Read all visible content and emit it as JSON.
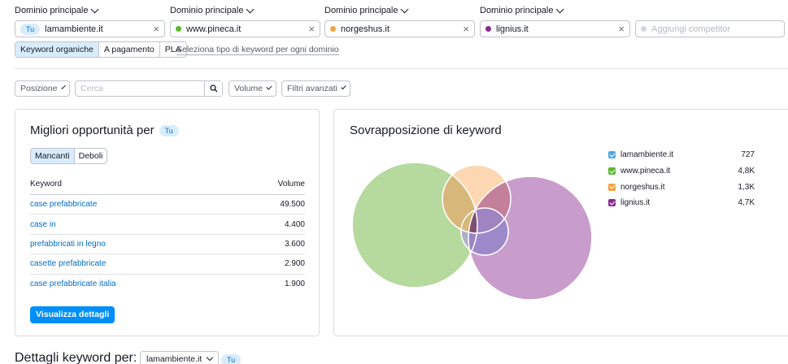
{
  "domains": [
    {
      "label": "Dominio principale",
      "value": "lamambiente.it",
      "badge": "Tu",
      "color": ""
    },
    {
      "label": "Dominio principale",
      "value": "www.pineca.it",
      "color": "#5ab82e"
    },
    {
      "label": "Dominio principale",
      "value": "norgeshus.it",
      "color": "#f7a241"
    },
    {
      "label": "Dominio principale",
      "value": "lignius.it",
      "color": "#8a2a8f"
    }
  ],
  "add_competitor_placeholder": "Aggiungi competitor",
  "close_glyph": "×",
  "keyword_types": {
    "organic": "Keyword organiche",
    "paid": "A pagamento",
    "pla": "PLA",
    "per_domain_link": "Seleziona tipo di keyword per ogni dominio"
  },
  "filters": {
    "position": "Posizione",
    "search_placeholder": "Cerca",
    "volume": "Volume",
    "advanced": "Filtri avanzati"
  },
  "opportunities": {
    "title": "Migliori opportunità per",
    "badge": "Tu",
    "toggle_missing": "Mancanti",
    "toggle_weak": "Deboli",
    "col_keyword": "Keyword",
    "col_volume": "Volume",
    "rows": [
      {
        "keyword": "case prefabbricate",
        "volume": "49.500"
      },
      {
        "keyword": "case in",
        "volume": "4.400"
      },
      {
        "keyword": "prefabbricati in legno",
        "volume": "3.600"
      },
      {
        "keyword": "casette prefabbricate",
        "volume": "2.900"
      },
      {
        "keyword": "case prefabbricate italia",
        "volume": "1.900"
      }
    ],
    "details_button": "Visualizza dettagli"
  },
  "overlap": {
    "title": "Sovrapposizione di keyword",
    "legend": [
      {
        "domain": "lamambiente.it",
        "count": "727",
        "color": "#4fa8e3"
      },
      {
        "domain": "www.pineca.it",
        "count": "4,8K",
        "color": "#5ab82e"
      },
      {
        "domain": "norgeshus.it",
        "count": "1,3K",
        "color": "#f7a241"
      },
      {
        "domain": "lignius.it",
        "count": "4,7K",
        "color": "#8a2a8f"
      }
    ]
  },
  "bottom": {
    "title": "Dettagli keyword per:",
    "selected_domain": "lamambiente.it",
    "badge": "Tu"
  }
}
